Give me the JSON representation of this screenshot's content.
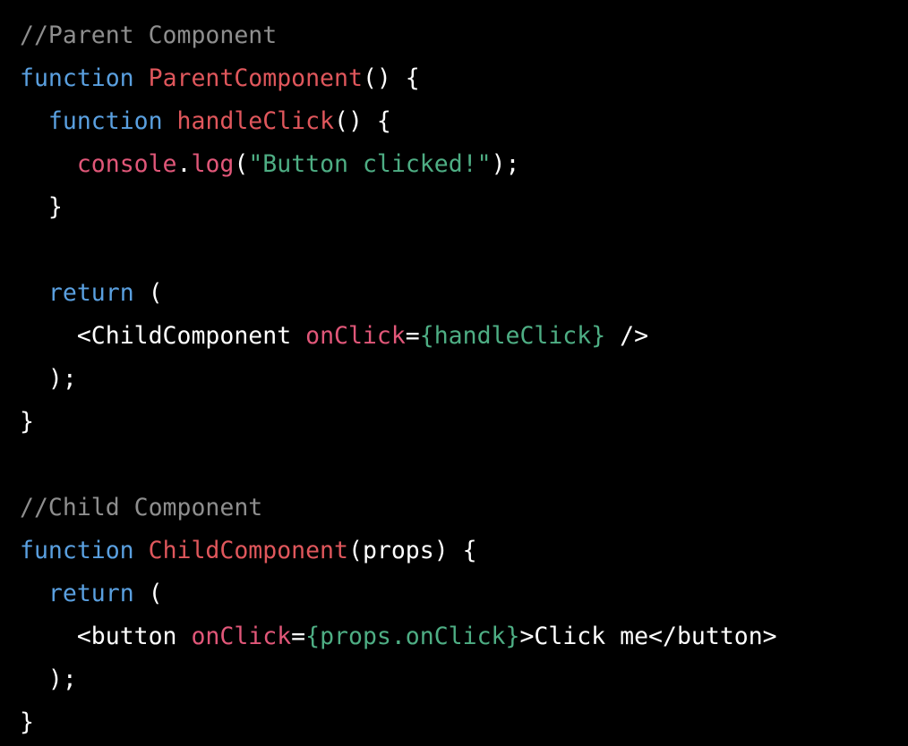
{
  "colors": {
    "background": "#000000",
    "comment": "#8e8e8e",
    "keyword": "#5aa0e0",
    "function_name": "#e0575c",
    "identifier": "#e15779",
    "string": "#4eae84",
    "plain": "#ffffff"
  },
  "code": {
    "lines": [
      [
        {
          "t": "comment",
          "v": "//Parent Component"
        }
      ],
      [
        {
          "t": "keyword",
          "v": "function"
        },
        {
          "t": "text",
          "v": " "
        },
        {
          "t": "fname",
          "v": "ParentComponent"
        },
        {
          "t": "punct",
          "v": "() {"
        }
      ],
      [
        {
          "t": "text",
          "v": "  "
        },
        {
          "t": "keyword",
          "v": "function"
        },
        {
          "t": "text",
          "v": " "
        },
        {
          "t": "fname",
          "v": "handleClick"
        },
        {
          "t": "punct",
          "v": "() {"
        }
      ],
      [
        {
          "t": "text",
          "v": "    "
        },
        {
          "t": "ident",
          "v": "console"
        },
        {
          "t": "punct",
          "v": "."
        },
        {
          "t": "ident",
          "v": "log"
        },
        {
          "t": "punct",
          "v": "("
        },
        {
          "t": "string",
          "v": "\"Button clicked!\""
        },
        {
          "t": "punct",
          "v": ");"
        }
      ],
      [
        {
          "t": "text",
          "v": "  "
        },
        {
          "t": "punct",
          "v": "}"
        }
      ],
      [],
      [
        {
          "t": "text",
          "v": "  "
        },
        {
          "t": "keyword",
          "v": "return"
        },
        {
          "t": "punct",
          "v": " ("
        }
      ],
      [
        {
          "t": "text",
          "v": "    "
        },
        {
          "t": "text",
          "v": "<ChildComponent "
        },
        {
          "t": "attr",
          "v": "onClick"
        },
        {
          "t": "punct",
          "v": "="
        },
        {
          "t": "expr",
          "v": "{handleClick}"
        },
        {
          "t": "text",
          "v": " />"
        }
      ],
      [
        {
          "t": "text",
          "v": "  "
        },
        {
          "t": "punct",
          "v": ");"
        }
      ],
      [
        {
          "t": "punct",
          "v": "}"
        }
      ],
      [],
      [
        {
          "t": "comment",
          "v": "//Child Component"
        }
      ],
      [
        {
          "t": "keyword",
          "v": "function"
        },
        {
          "t": "text",
          "v": " "
        },
        {
          "t": "fname",
          "v": "ChildComponent"
        },
        {
          "t": "punct",
          "v": "(props) {"
        }
      ],
      [
        {
          "t": "text",
          "v": "  "
        },
        {
          "t": "keyword",
          "v": "return"
        },
        {
          "t": "punct",
          "v": " ("
        }
      ],
      [
        {
          "t": "text",
          "v": "    "
        },
        {
          "t": "text",
          "v": "<button "
        },
        {
          "t": "attr",
          "v": "onClick"
        },
        {
          "t": "punct",
          "v": "="
        },
        {
          "t": "expr",
          "v": "{props.onClick}"
        },
        {
          "t": "text",
          "v": ">Click me</button>"
        }
      ],
      [
        {
          "t": "text",
          "v": "  "
        },
        {
          "t": "punct",
          "v": ");"
        }
      ],
      [
        {
          "t": "punct",
          "v": "}"
        }
      ]
    ]
  }
}
